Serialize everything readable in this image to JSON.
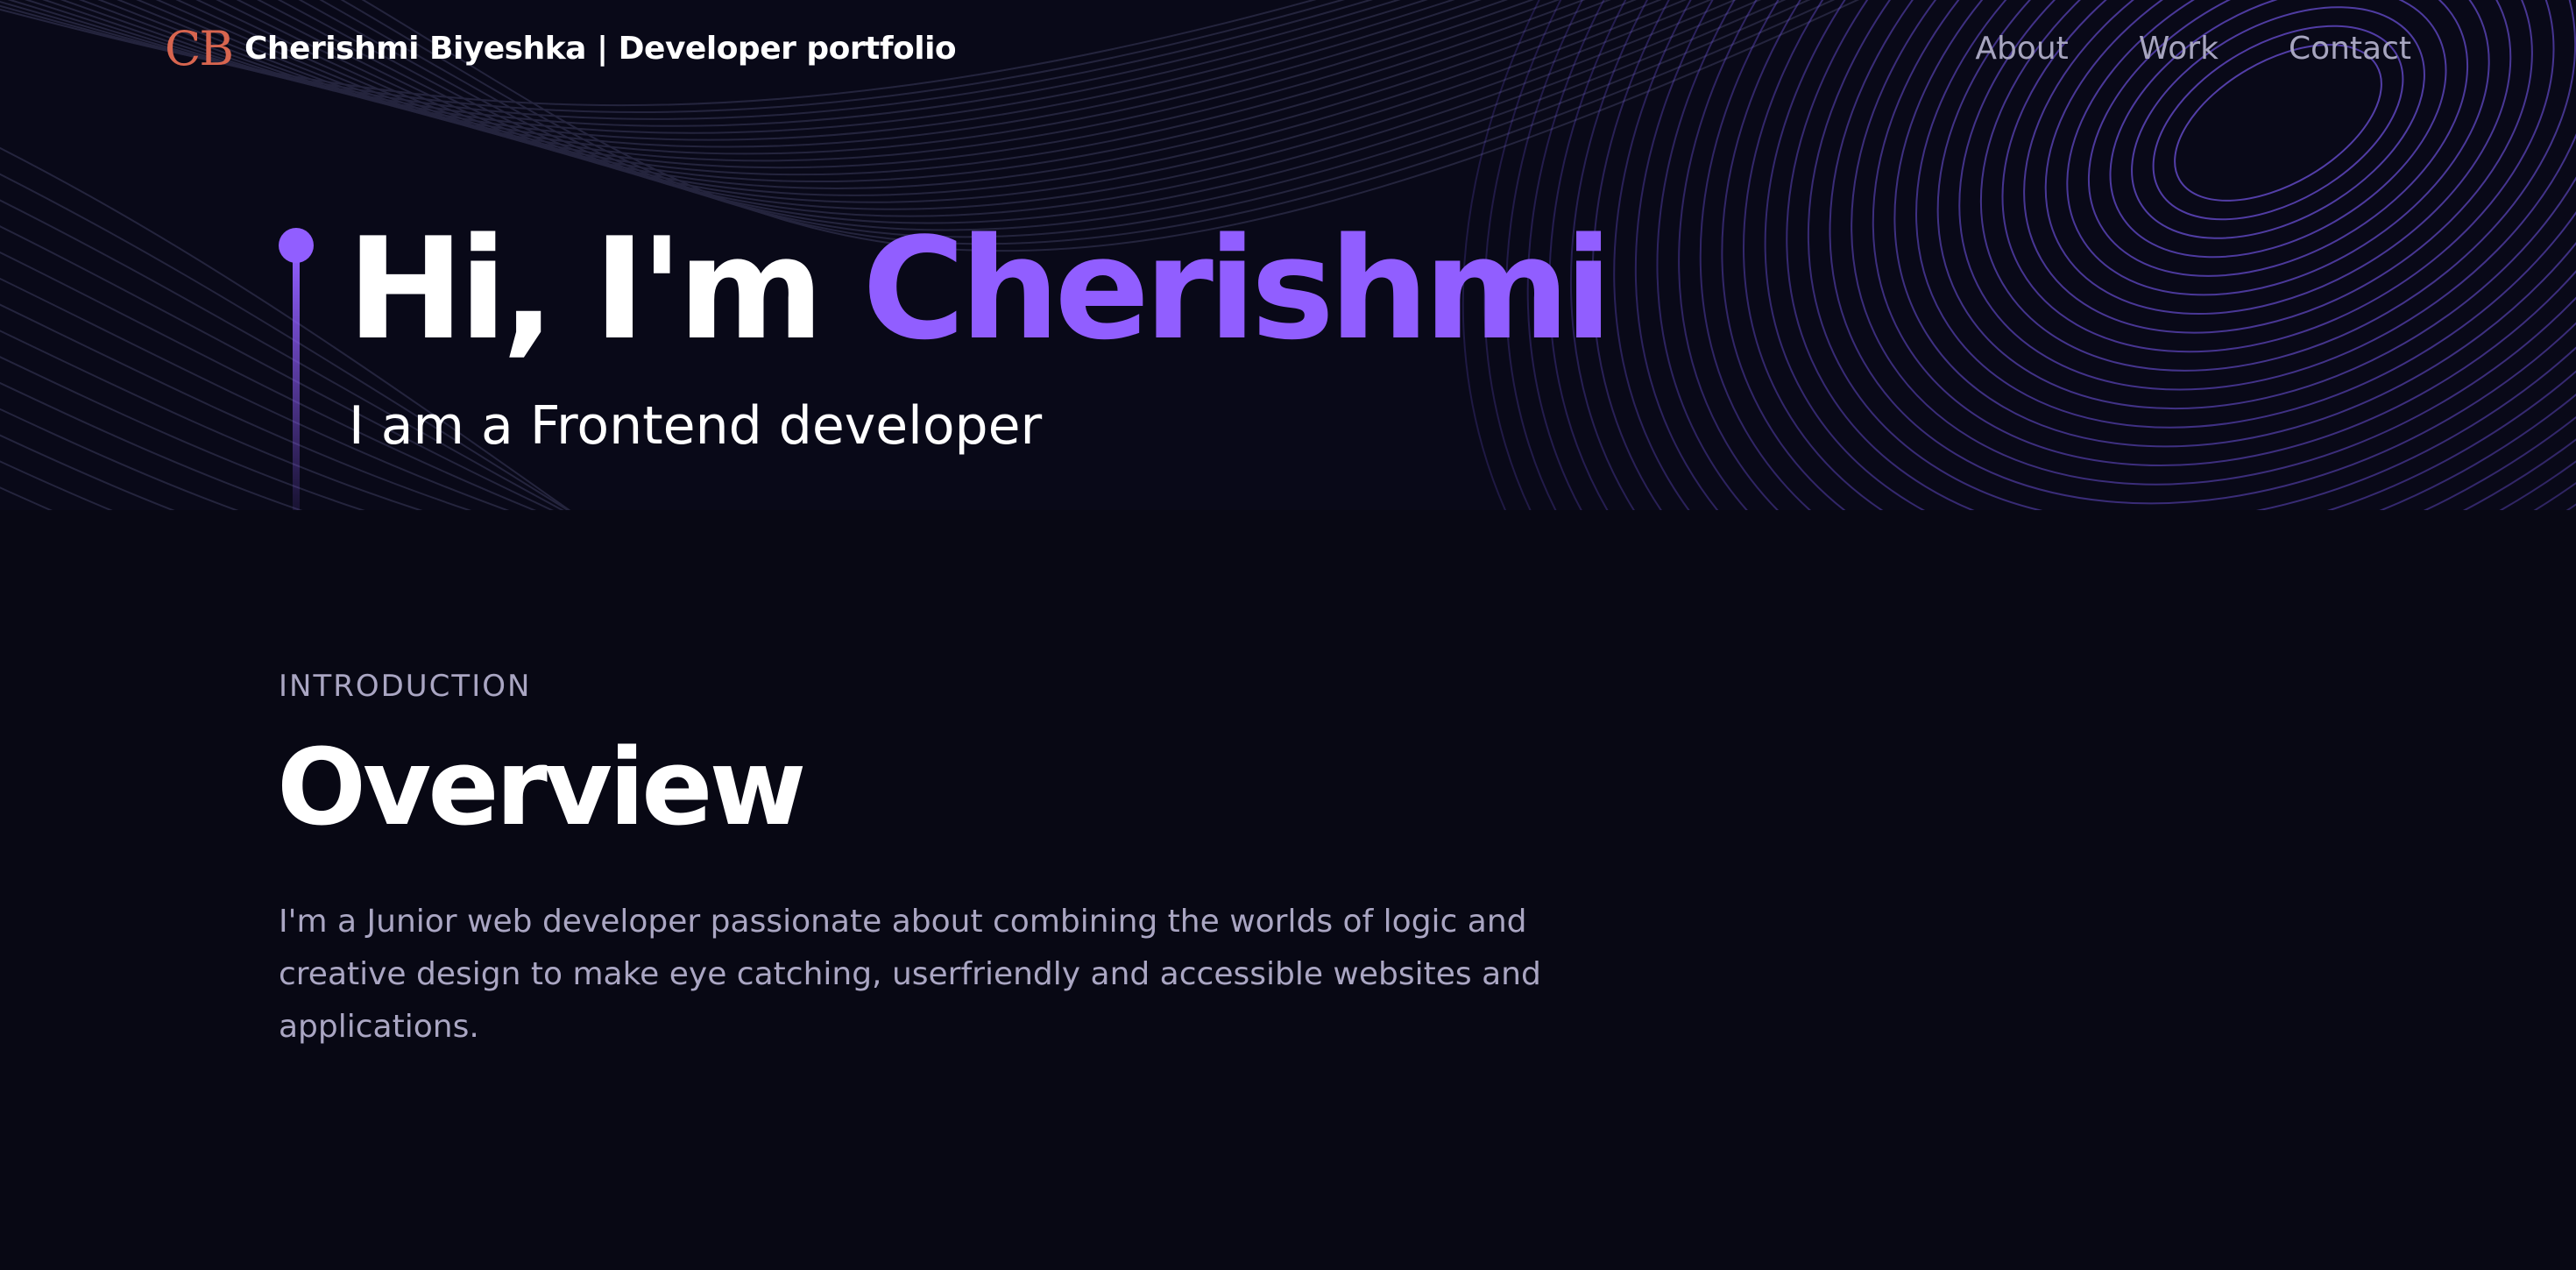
{
  "nav": {
    "logo_mark": "CB",
    "logo_text": "Cherishmi Biyeshka  | Developer portfolio",
    "links": [
      {
        "label": "About"
      },
      {
        "label": "Work"
      },
      {
        "label": "Contact"
      }
    ]
  },
  "hero": {
    "greeting": "Hi, I'm ",
    "name": "Cherishmi",
    "subtitle": "I am a Frontend developer"
  },
  "overview": {
    "eyebrow": "INTRODUCTION",
    "title": "Overview",
    "body": "I'm a Junior web developer passionate about combining the worlds of logic and creative design to make eye catching, userfriendly and accessible websites and applications."
  },
  "colors": {
    "background": "#080814",
    "accent": "#915eff",
    "logo": "#d8654f",
    "muted_text": "#aaa6c3"
  }
}
